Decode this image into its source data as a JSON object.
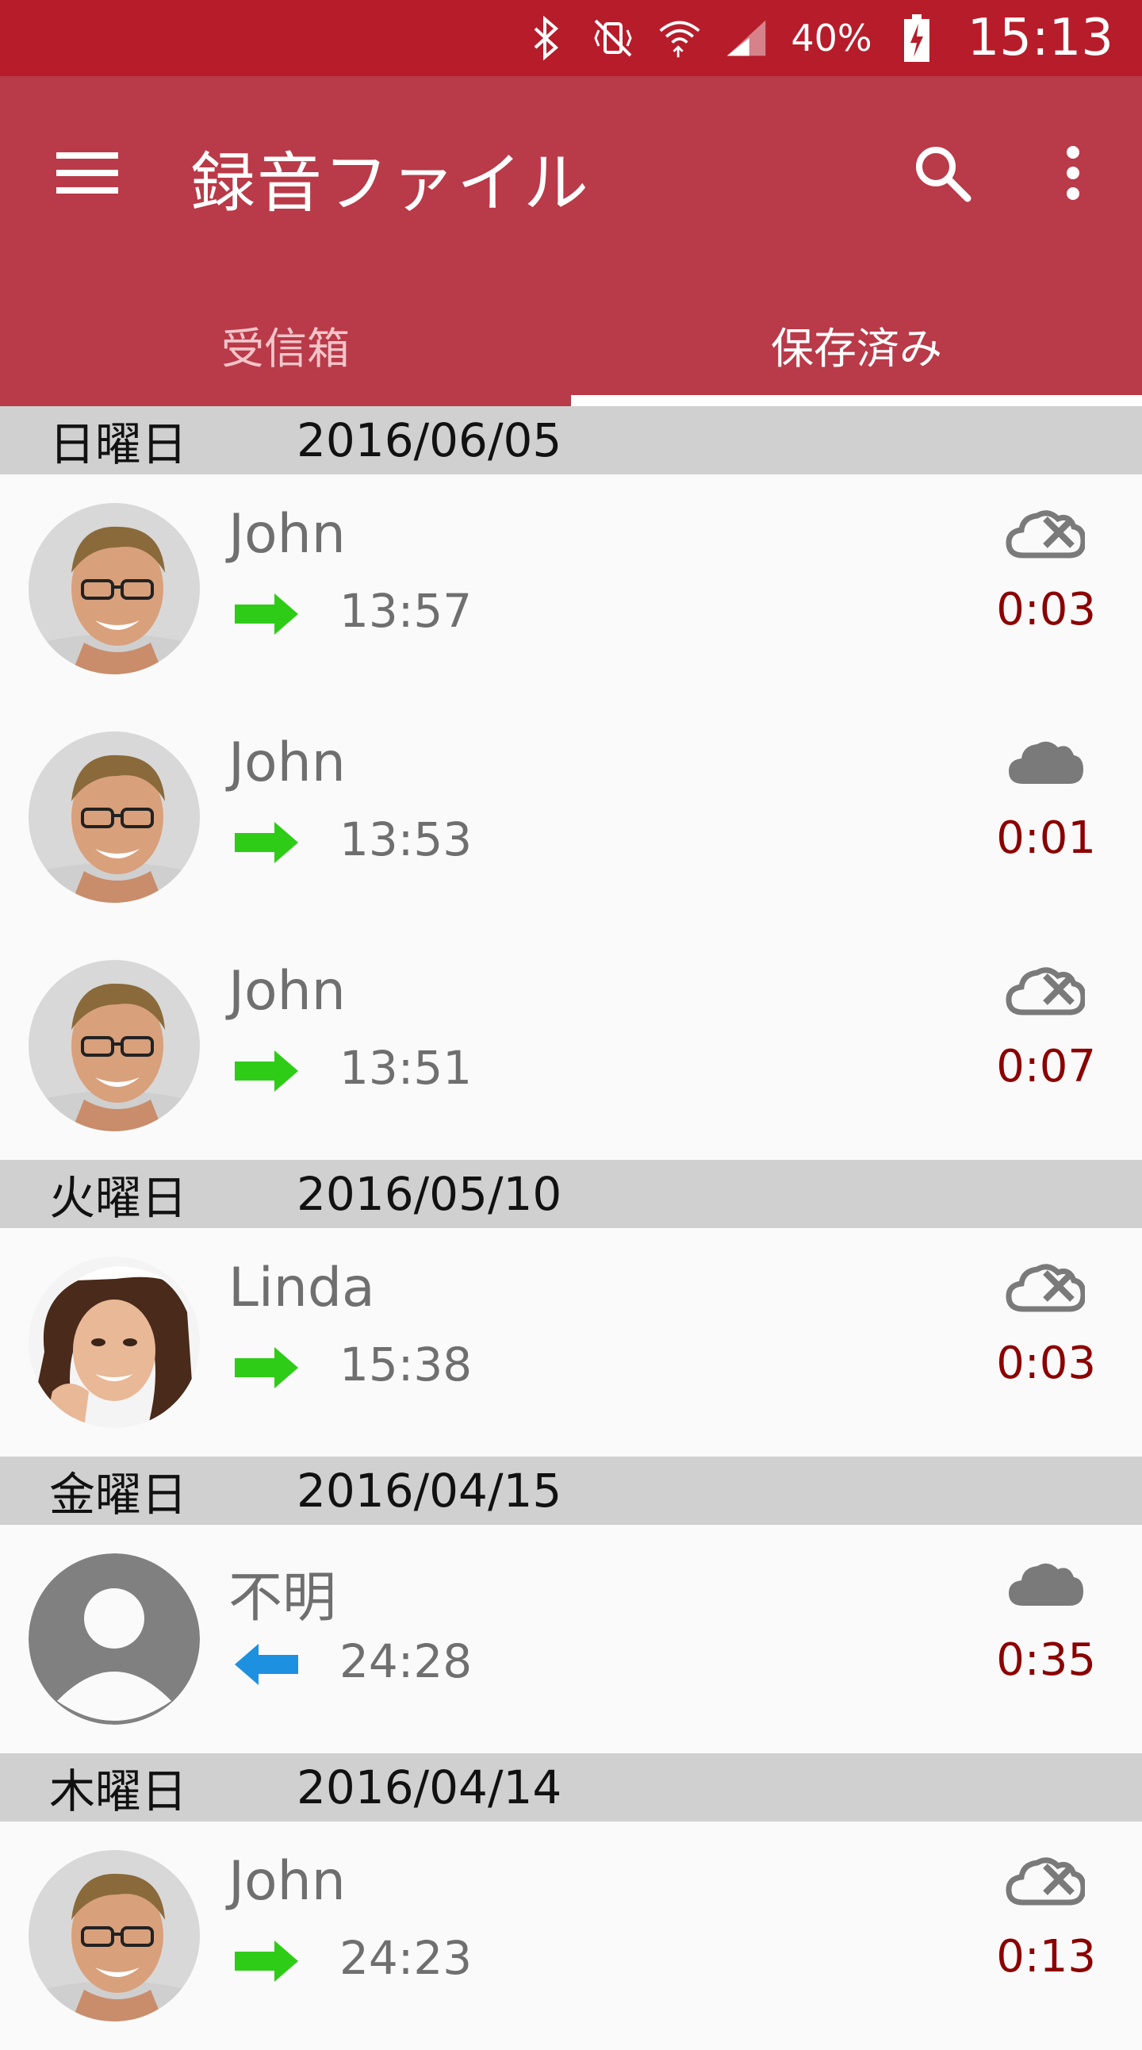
{
  "status_bar": {
    "battery": "40%",
    "time": "15:13"
  },
  "app_bar": {
    "title": "録音ファイル"
  },
  "tabs": [
    {
      "label": "受信箱",
      "active": false
    },
    {
      "label": "保存済み",
      "active": true
    }
  ],
  "colors": {
    "status_bar": "#b71c2a",
    "app_bar": "#b93a48",
    "duration": "#8b0000",
    "outgoing_arrow": "#2ecc17",
    "incoming_arrow": "#1e90e0"
  },
  "sections": [
    {
      "day": "日曜日",
      "date": "2016/06/05",
      "entries": [
        {
          "name": "John",
          "time": "13:57",
          "duration": "0:03",
          "direction": "outgoing",
          "cloud": "cloud-off-icon",
          "avatar": "john"
        },
        {
          "name": "John",
          "time": "13:53",
          "duration": "0:01",
          "direction": "outgoing",
          "cloud": "cloud-icon",
          "avatar": "john"
        },
        {
          "name": "John",
          "time": "13:51",
          "duration": "0:07",
          "direction": "outgoing",
          "cloud": "cloud-off-icon",
          "avatar": "john"
        }
      ]
    },
    {
      "day": "火曜日",
      "date": "2016/05/10",
      "entries": [
        {
          "name": "Linda",
          "time": "15:38",
          "duration": "0:03",
          "direction": "outgoing",
          "cloud": "cloud-off-icon",
          "avatar": "linda"
        }
      ]
    },
    {
      "day": "金曜日",
      "date": "2016/04/15",
      "entries": [
        {
          "name": "不明",
          "time": "24:28",
          "duration": "0:35",
          "direction": "incoming",
          "cloud": "cloud-icon",
          "avatar": "unknown"
        }
      ]
    },
    {
      "day": "木曜日",
      "date": "2016/04/14",
      "entries": [
        {
          "name": "John",
          "time": "24:23",
          "duration": "0:13",
          "direction": "outgoing",
          "cloud": "cloud-off-icon",
          "avatar": "john"
        }
      ]
    }
  ]
}
